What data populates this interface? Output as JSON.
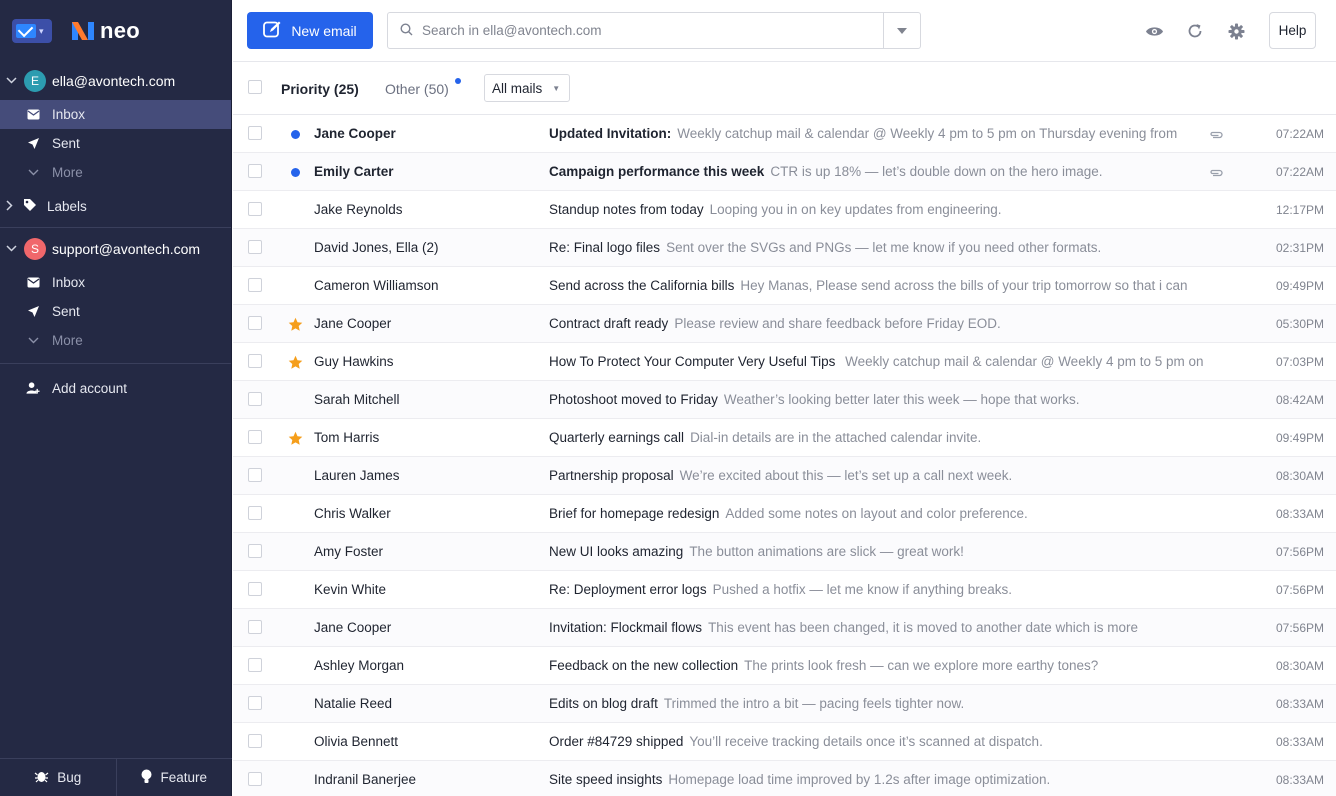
{
  "app": {
    "logo_text": "neo"
  },
  "sidebar": {
    "accounts": [
      {
        "email": "ella@avontech.com",
        "initial": "E",
        "avatar_color": "#2c9cb0",
        "folders": [
          {
            "label": "Inbox",
            "icon": "inbox-icon",
            "active": true
          },
          {
            "label": "Sent",
            "icon": "send-icon",
            "active": false
          },
          {
            "label": "More",
            "icon": "chevron-down-icon",
            "active": false
          }
        ],
        "labels": "Labels"
      },
      {
        "email": "support@avontech.com",
        "initial": "S",
        "avatar_color": "#f0676b",
        "folders": [
          {
            "label": "Inbox",
            "icon": "inbox-icon",
            "active": false
          },
          {
            "label": "Sent",
            "icon": "send-icon",
            "active": false
          },
          {
            "label": "More",
            "icon": "chevron-down-icon",
            "active": false
          }
        ]
      }
    ],
    "add_account": "Add account",
    "bottom": {
      "bug": "Bug",
      "feature": "Feature"
    }
  },
  "toolbar": {
    "new_email": "New email",
    "search_placeholder": "Search in ella@avontech.com",
    "help": "Help",
    "accent": "#2563eb"
  },
  "tabs": {
    "priority": "Priority (25)",
    "other": "Other (50)",
    "filter": "All mails"
  },
  "emails": [
    {
      "sender": "Jane Cooper",
      "subject": "Updated Invitation:",
      "preview": "Weekly catchup mail & calendar @ Weekly 4 pm to 5 pm on Thursday evening from",
      "time": "07:22AM",
      "unread": true,
      "starred": false,
      "attachment": true
    },
    {
      "sender": "Emily Carter",
      "subject": "Campaign performance this week",
      "preview": "CTR is up 18% — let’s double down on the hero image.",
      "time": "07:22AM",
      "unread": true,
      "starred": false,
      "attachment": true
    },
    {
      "sender": "Jake Reynolds",
      "subject": "Standup notes from today",
      "preview": "Looping you in on key updates from engineering.",
      "time": "12:17PM",
      "unread": false,
      "starred": false,
      "attachment": false
    },
    {
      "sender": "David Jones, Ella (2)",
      "subject": "Re: Final logo files",
      "preview": "Sent over the SVGs and PNGs — let me know if you need other formats.",
      "time": "02:31PM",
      "unread": false,
      "starred": false,
      "attachment": false
    },
    {
      "sender": "Cameron Williamson",
      "subject": "Send across the California bills",
      "preview": "Hey Manas, Please send across the bills of your trip tomorrow so that i can",
      "time": "09:49PM",
      "unread": false,
      "starred": false,
      "attachment": false
    },
    {
      "sender": "Jane Cooper",
      "subject": "Contract draft ready",
      "preview": "Please review and share feedback before Friday EOD.",
      "time": "05:30PM",
      "unread": false,
      "starred": true,
      "attachment": false
    },
    {
      "sender": "Guy Hawkins",
      "subject": "How To Protect Your Computer Very Useful Tips",
      "preview": "  Weekly catchup mail & calendar @ Weekly 4 pm to 5 pm on",
      "time": "07:03PM",
      "unread": false,
      "starred": true,
      "attachment": false
    },
    {
      "sender": "Sarah Mitchell",
      "subject": "Photoshoot moved to Friday",
      "preview": "Weather’s looking better later this week — hope that works.",
      "time": "08:42AM",
      "unread": false,
      "starred": false,
      "attachment": false
    },
    {
      "sender": "Tom Harris",
      "subject": "Quarterly earnings call",
      "preview": "Dial-in details are in the attached calendar invite.",
      "time": "09:49PM",
      "unread": false,
      "starred": true,
      "attachment": false
    },
    {
      "sender": "Lauren James",
      "subject": "Partnership proposal",
      "preview": "We’re excited about this — let’s set up a call next week.",
      "time": "08:30AM",
      "unread": false,
      "starred": false,
      "attachment": false
    },
    {
      "sender": "Chris Walker",
      "subject": "Brief for homepage redesign",
      "preview": "Added some notes on layout and color preference.",
      "time": "08:33AM",
      "unread": false,
      "starred": false,
      "attachment": false
    },
    {
      "sender": "Amy Foster",
      "subject": "New UI looks amazing",
      "preview": "The button animations are slick — great work!",
      "time": "07:56PM",
      "unread": false,
      "starred": false,
      "attachment": false
    },
    {
      "sender": "Kevin White",
      "subject": "Re: Deployment error logs",
      "preview": "Pushed a hotfix — let me know if anything breaks.",
      "time": "07:56PM",
      "unread": false,
      "starred": false,
      "attachment": false
    },
    {
      "sender": "Jane Cooper",
      "subject": "Invitation: Flockmail flows",
      "preview": "This event has been changed, it is moved to another date which is more",
      "time": "07:56PM",
      "unread": false,
      "starred": false,
      "attachment": false
    },
    {
      "sender": "Ashley Morgan",
      "subject": "Feedback on the new collection",
      "preview": "The prints look fresh — can we explore more earthy tones?",
      "time": "08:30AM",
      "unread": false,
      "starred": false,
      "attachment": false
    },
    {
      "sender": "Natalie Reed",
      "subject": "Edits on blog draft",
      "preview": "Trimmed the intro a bit — pacing feels tighter now.",
      "time": "08:33AM",
      "unread": false,
      "starred": false,
      "attachment": false
    },
    {
      "sender": "Olivia Bennett",
      "subject": "Order #84729 shipped",
      "preview": "You’ll receive tracking details once it’s scanned at dispatch.",
      "time": "08:33AM",
      "unread": false,
      "starred": false,
      "attachment": false
    },
    {
      "sender": "Indranil Banerjee",
      "subject": "Site speed insights",
      "preview": "Homepage load time improved by 1.2s after image optimization.",
      "time": "08:33AM",
      "unread": false,
      "starred": false,
      "attachment": false
    }
  ]
}
